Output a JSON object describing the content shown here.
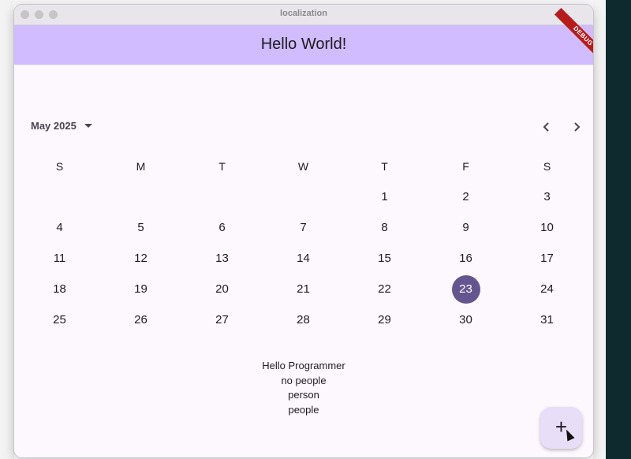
{
  "window": {
    "title": "localization"
  },
  "app_bar": {
    "title": "Hello World!"
  },
  "debug_banner": "DEBUG",
  "calendar": {
    "month_label": "May 2025",
    "weekdays": [
      "S",
      "M",
      "T",
      "W",
      "T",
      "F",
      "S"
    ],
    "weeks": [
      [
        "",
        "",
        "",
        "",
        "1",
        "2",
        "3"
      ],
      [
        "4",
        "5",
        "6",
        "7",
        "8",
        "9",
        "10"
      ],
      [
        "11",
        "12",
        "13",
        "14",
        "15",
        "16",
        "17"
      ],
      [
        "18",
        "19",
        "20",
        "21",
        "22",
        "23",
        "24"
      ],
      [
        "25",
        "26",
        "27",
        "28",
        "29",
        "30",
        "31"
      ]
    ],
    "selected_day": "23",
    "prev_icon": "chevron-left-icon",
    "next_icon": "chevron-right-icon"
  },
  "messages": [
    "Hello Programmer",
    "no people",
    "person",
    "people"
  ],
  "fab": {
    "icon": "plus-icon",
    "glyph": "+"
  },
  "colors": {
    "app_bar": "#d0bcfe",
    "background": "#fdf7fe",
    "selected": "#65558f",
    "fab": "#e8def8"
  }
}
